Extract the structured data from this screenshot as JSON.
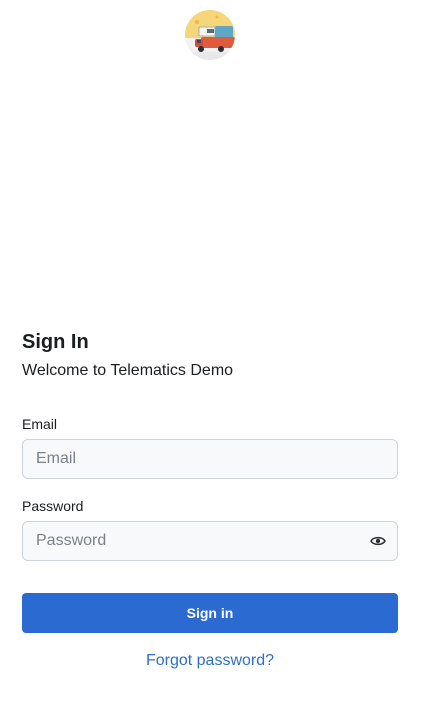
{
  "brand": {
    "logo_icon": "truck-logo-icon"
  },
  "signin": {
    "title": "Sign In",
    "subtitle": "Welcome to Telematics Demo",
    "email_label": "Email",
    "email_placeholder": "Email",
    "email_value": "",
    "password_label": "Password",
    "password_placeholder": "Password",
    "password_value": "",
    "password_toggle_icon": "eye-icon",
    "submit_label": "Sign in",
    "forgot_label": "Forgot password?"
  },
  "colors": {
    "primary": "#2b6bd1",
    "link": "#2e6fc9",
    "input_bg": "#f8f9fb",
    "input_border": "#cfd4da"
  }
}
